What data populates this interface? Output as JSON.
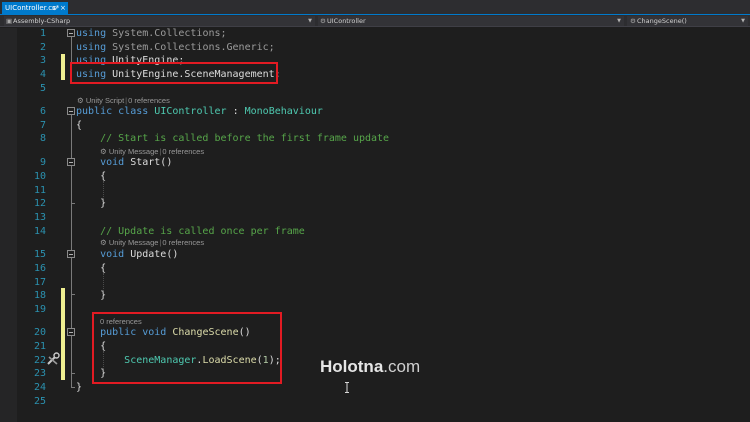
{
  "tab": {
    "label": "UIController.cs*",
    "pin": "⊕",
    "close": "×"
  },
  "navbar": {
    "project": "Assembly-CSharp",
    "class": "UIController",
    "member": "ChangeScene()"
  },
  "lines": [
    {
      "n": "1",
      "tokens": [
        {
          "t": "using",
          "c": "kw"
        },
        {
          "t": " System.Collections;",
          "c": "gray"
        }
      ]
    },
    {
      "n": "2",
      "tokens": [
        {
          "t": "using",
          "c": "kw"
        },
        {
          "t": " System.Collections.Generic;",
          "c": "gray"
        }
      ]
    },
    {
      "n": "3",
      "tokens": [
        {
          "t": "using",
          "c": "kw"
        },
        {
          "t": " UnityEngine;",
          "c": ""
        }
      ]
    },
    {
      "n": "4",
      "tokens": [
        {
          "t": "using",
          "c": "kw"
        },
        {
          "t": " UnityEngine.SceneManagement;",
          "c": ""
        }
      ]
    },
    {
      "n": "5",
      "tokens": []
    },
    {
      "n": "6",
      "tokens": [
        {
          "t": "public",
          "c": "kw"
        },
        {
          "t": " ",
          "c": ""
        },
        {
          "t": "class",
          "c": "kw"
        },
        {
          "t": " ",
          "c": ""
        },
        {
          "t": "UIController",
          "c": "ty"
        },
        {
          "t": " : ",
          "c": ""
        },
        {
          "t": "MonoBehaviour",
          "c": "ty"
        }
      ]
    },
    {
      "n": "7",
      "tokens": [
        {
          "t": "{",
          "c": ""
        }
      ]
    },
    {
      "n": "8",
      "tokens": [
        {
          "t": "    // Start is called before the first frame update",
          "c": "cm"
        }
      ]
    },
    {
      "n": "9",
      "tokens": [
        {
          "t": "    ",
          "c": ""
        },
        {
          "t": "void",
          "c": "kw"
        },
        {
          "t": " Start()",
          "c": ""
        }
      ]
    },
    {
      "n": "10",
      "tokens": [
        {
          "t": "    {",
          "c": ""
        }
      ]
    },
    {
      "n": "11",
      "tokens": []
    },
    {
      "n": "12",
      "tokens": [
        {
          "t": "    }",
          "c": ""
        }
      ]
    },
    {
      "n": "13",
      "tokens": []
    },
    {
      "n": "14",
      "tokens": [
        {
          "t": "    // Update is called once per frame",
          "c": "cm"
        }
      ]
    },
    {
      "n": "15",
      "tokens": [
        {
          "t": "    ",
          "c": ""
        },
        {
          "t": "void",
          "c": "kw"
        },
        {
          "t": " Update()",
          "c": ""
        }
      ]
    },
    {
      "n": "16",
      "tokens": [
        {
          "t": "    {",
          "c": ""
        }
      ]
    },
    {
      "n": "17",
      "tokens": []
    },
    {
      "n": "18",
      "tokens": [
        {
          "t": "    }",
          "c": ""
        }
      ]
    },
    {
      "n": "19",
      "tokens": []
    },
    {
      "n": "20",
      "tokens": [
        {
          "t": "    ",
          "c": ""
        },
        {
          "t": "public",
          "c": "kw"
        },
        {
          "t": " ",
          "c": ""
        },
        {
          "t": "void",
          "c": "kw"
        },
        {
          "t": " ",
          "c": ""
        },
        {
          "t": "ChangeScene",
          "c": "fn"
        },
        {
          "t": "()",
          "c": ""
        }
      ]
    },
    {
      "n": "21",
      "tokens": [
        {
          "t": "    {",
          "c": ""
        }
      ]
    },
    {
      "n": "22",
      "tokens": [
        {
          "t": "        ",
          "c": ""
        },
        {
          "t": "SceneManager",
          "c": "ty"
        },
        {
          "t": ".",
          "c": ""
        },
        {
          "t": "LoadScene",
          "c": "fn"
        },
        {
          "t": "(",
          "c": ""
        },
        {
          "t": "1",
          "c": "num"
        },
        {
          "t": ");",
          "c": ""
        }
      ]
    },
    {
      "n": "23",
      "tokens": [
        {
          "t": "    }",
          "c": ""
        }
      ]
    },
    {
      "n": "24",
      "tokens": [
        {
          "t": "}",
          "c": ""
        }
      ]
    },
    {
      "n": "25",
      "tokens": []
    }
  ],
  "codelens": {
    "class": {
      "kind": "Unity Script",
      "refs": "0 references"
    },
    "start": {
      "kind": "Unity Message",
      "refs": "0 references"
    },
    "update": {
      "kind": "Unity Message",
      "refs": "0 references"
    },
    "changescene": {
      "refs": "0 references"
    }
  },
  "watermark": {
    "brand": "Holotna",
    "domain": ".com"
  },
  "colors": {
    "keyword": "#569cd6",
    "type": "#4ec9b0",
    "comment": "#57a64a",
    "line_number": "#2b91af",
    "highlight_box": "#e21b23",
    "accent": "#007acc"
  }
}
